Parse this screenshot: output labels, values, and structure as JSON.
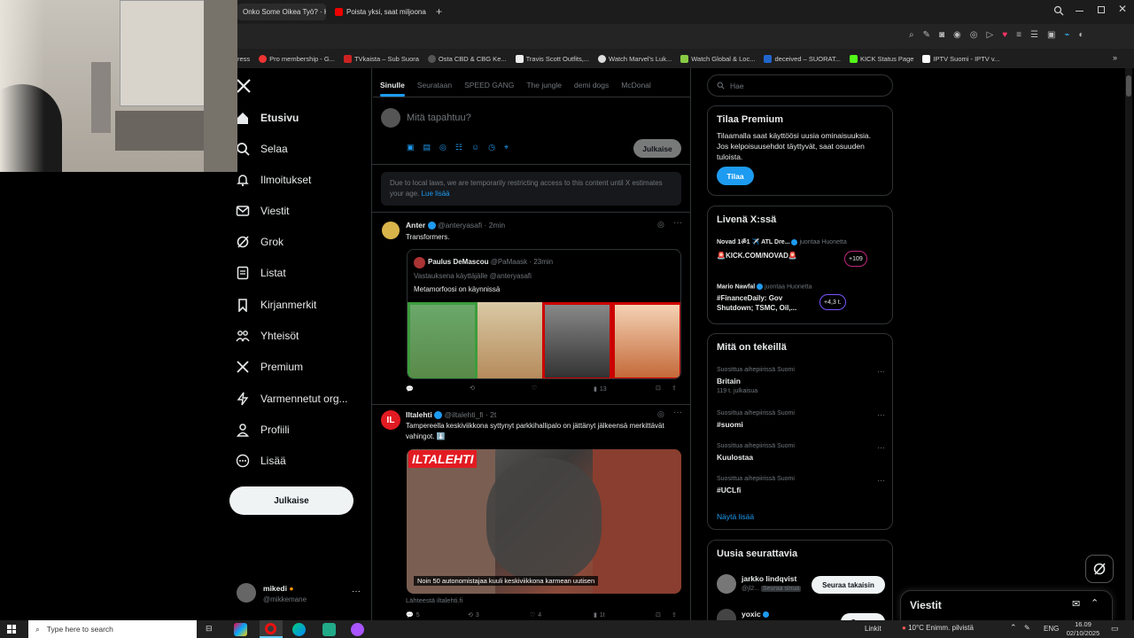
{
  "browser": {
    "tabs": [
      {
        "label": "Onko Some Oikea Työ? · K"
      },
      {
        "label": "Poista yksi, saat miljoona"
      }
    ],
    "bookmarks": [
      "ress",
      "Pro membership - G...",
      "TVkaista – Sub Suora",
      "Osta CBD & CBG Ke...",
      "Travis Scott Outfits,...",
      "Watch Marvel's Luk...",
      "Watch Global & Loc...",
      "deceived – SUORAT...",
      "KICK Status Page",
      "IPTV Suomi - IPTV v..."
    ]
  },
  "sidebar": {
    "items": [
      {
        "label": "Etusivu"
      },
      {
        "label": "Selaa"
      },
      {
        "label": "Ilmoitukset"
      },
      {
        "label": "Viestit"
      },
      {
        "label": "Grok"
      },
      {
        "label": "Listat"
      },
      {
        "label": "Kirjanmerkit"
      },
      {
        "label": "Yhteisöt"
      },
      {
        "label": "Premium"
      },
      {
        "label": "Varmennetut org..."
      },
      {
        "label": "Profiili"
      },
      {
        "label": "Lisää"
      }
    ],
    "post_button": "Julkaise",
    "account": {
      "name": "mikedi",
      "handle": "@mikkemane"
    }
  },
  "feed": {
    "tabs": [
      "Sinulle",
      "Seurataan",
      "SPEED GANG",
      "The jungle",
      "demi dogs",
      "McDonal"
    ],
    "composer": {
      "placeholder": "Mitä tapahtuu?",
      "post_label": "Julkaise"
    },
    "notice": {
      "text": "Due to local laws, we are temporarily restricting access to this content until X estimates your age.",
      "link": "Lue lisää"
    },
    "tweets": [
      {
        "name": "Anter",
        "handle": "@anteryasafi",
        "time": "· 2min",
        "text": "Transformers.",
        "quote": {
          "name": "Paulus DeMascou",
          "handle": "@PaMaask",
          "time": "· 23min",
          "reply_to": "Vastauksena käyttäjälle @anteryasafi",
          "text": "Metamorfoosi on käynnissä"
        },
        "views": "13"
      },
      {
        "name": "Iltalehti",
        "handle": "@iltalehti_fi",
        "time": "· 2t",
        "text": "Tampereella keskiviikkona syttynyt parkkihallipalo on jättänyt jälkeensä merkittävät vahingot. ⬇️",
        "image_logo": "ILTALEHTI",
        "caption": "Noin 50 autonomistajaa kuuli keskiviikkona karmean uutisen",
        "source": "Lähteestä iltalehti.fi",
        "replies": "5",
        "retweets": "3",
        "likes": "4",
        "views": "1t"
      }
    ]
  },
  "right": {
    "search_placeholder": "Hae",
    "premium": {
      "title": "Tilaa Premium",
      "text": "Tilaamalla saat käyttöösi uusia ominaisuuksia. Jos kelpoisuusehdot täyttyvät, saat osuuden tuloista.",
      "button": "Tilaa"
    },
    "live": {
      "title": "Livenä X:ssä",
      "items": [
        {
          "host": "Novad 1ॐ1 ✈️ ATL Dre...",
          "action": "juontaa Huonetta",
          "title": "🚨KICK.COM/NOVAD🚨",
          "count": "+109"
        },
        {
          "host": "Mario Nawfal",
          "action": "juontaa Huonetta",
          "title": "#FinanceDaily: Gov Shutdown; TSMC, Oil,...",
          "count": "+4,3 t."
        }
      ]
    },
    "trends": {
      "title": "Mitä on tekeillä",
      "items": [
        {
          "context": "Suosittua aihepiirissä Suomi",
          "name": "Britain",
          "count": "119 t. julkaisua"
        },
        {
          "context": "Suosittua aihepiirissä Suomi",
          "name": "#suomi",
          "count": ""
        },
        {
          "context": "Suosittua aihepiirissä Suomi",
          "name": "Kuulostaa",
          "count": ""
        },
        {
          "context": "Suosittua aihepiirissä Suomi",
          "name": "#UCLfi",
          "count": ""
        }
      ],
      "more": "Näytä lisää"
    },
    "follow": {
      "title": "Uusia seurattavia",
      "items": [
        {
          "name": "jarkko lindqvist",
          "handle": "@jl2...",
          "badge": "Seuraa sinua",
          "button": "Seuraa takaisin"
        },
        {
          "name": "yoxic",
          "handle": "",
          "badge": "",
          "button": "Seuraa"
        }
      ]
    },
    "messages": {
      "title": "Viestit"
    }
  },
  "taskbar": {
    "search_placeholder": "Type here to search",
    "links": "Linkit",
    "weather": "10°C  Enimm. pilvistä",
    "lang": "ENG",
    "time": "16.09",
    "date": "02/10/2025"
  }
}
